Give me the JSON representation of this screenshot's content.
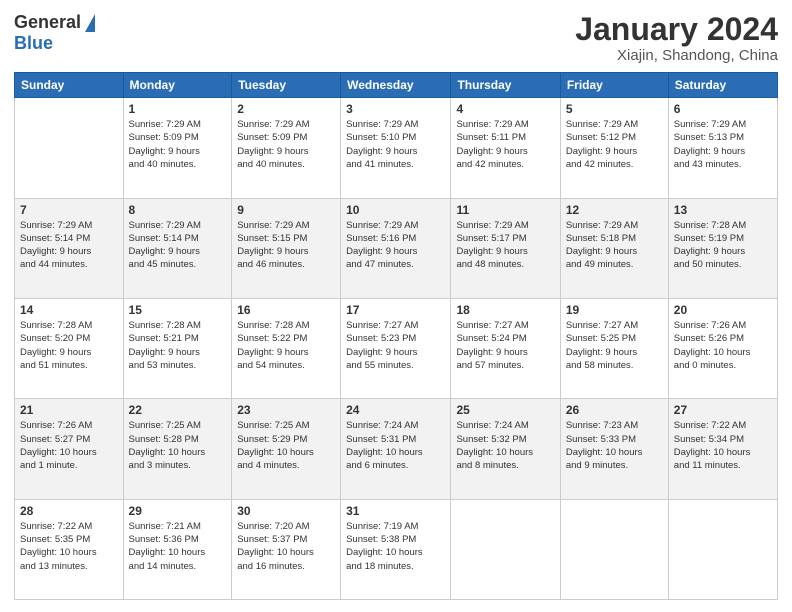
{
  "logo": {
    "general": "General",
    "blue": "Blue"
  },
  "header": {
    "title": "January 2024",
    "subtitle": "Xiajin, Shandong, China"
  },
  "days_of_week": [
    "Sunday",
    "Monday",
    "Tuesday",
    "Wednesday",
    "Thursday",
    "Friday",
    "Saturday"
  ],
  "weeks": [
    {
      "row_class": "normal",
      "days": [
        {
          "number": "",
          "info": ""
        },
        {
          "number": "1",
          "info": "Sunrise: 7:29 AM\nSunset: 5:09 PM\nDaylight: 9 hours\nand 40 minutes."
        },
        {
          "number": "2",
          "info": "Sunrise: 7:29 AM\nSunset: 5:09 PM\nDaylight: 9 hours\nand 40 minutes."
        },
        {
          "number": "3",
          "info": "Sunrise: 7:29 AM\nSunset: 5:10 PM\nDaylight: 9 hours\nand 41 minutes."
        },
        {
          "number": "4",
          "info": "Sunrise: 7:29 AM\nSunset: 5:11 PM\nDaylight: 9 hours\nand 42 minutes."
        },
        {
          "number": "5",
          "info": "Sunrise: 7:29 AM\nSunset: 5:12 PM\nDaylight: 9 hours\nand 42 minutes."
        },
        {
          "number": "6",
          "info": "Sunrise: 7:29 AM\nSunset: 5:13 PM\nDaylight: 9 hours\nand 43 minutes."
        }
      ]
    },
    {
      "row_class": "alt",
      "days": [
        {
          "number": "7",
          "info": "Sunrise: 7:29 AM\nSunset: 5:14 PM\nDaylight: 9 hours\nand 44 minutes."
        },
        {
          "number": "8",
          "info": "Sunrise: 7:29 AM\nSunset: 5:14 PM\nDaylight: 9 hours\nand 45 minutes."
        },
        {
          "number": "9",
          "info": "Sunrise: 7:29 AM\nSunset: 5:15 PM\nDaylight: 9 hours\nand 46 minutes."
        },
        {
          "number": "10",
          "info": "Sunrise: 7:29 AM\nSunset: 5:16 PM\nDaylight: 9 hours\nand 47 minutes."
        },
        {
          "number": "11",
          "info": "Sunrise: 7:29 AM\nSunset: 5:17 PM\nDaylight: 9 hours\nand 48 minutes."
        },
        {
          "number": "12",
          "info": "Sunrise: 7:29 AM\nSunset: 5:18 PM\nDaylight: 9 hours\nand 49 minutes."
        },
        {
          "number": "13",
          "info": "Sunrise: 7:28 AM\nSunset: 5:19 PM\nDaylight: 9 hours\nand 50 minutes."
        }
      ]
    },
    {
      "row_class": "normal",
      "days": [
        {
          "number": "14",
          "info": "Sunrise: 7:28 AM\nSunset: 5:20 PM\nDaylight: 9 hours\nand 51 minutes."
        },
        {
          "number": "15",
          "info": "Sunrise: 7:28 AM\nSunset: 5:21 PM\nDaylight: 9 hours\nand 53 minutes."
        },
        {
          "number": "16",
          "info": "Sunrise: 7:28 AM\nSunset: 5:22 PM\nDaylight: 9 hours\nand 54 minutes."
        },
        {
          "number": "17",
          "info": "Sunrise: 7:27 AM\nSunset: 5:23 PM\nDaylight: 9 hours\nand 55 minutes."
        },
        {
          "number": "18",
          "info": "Sunrise: 7:27 AM\nSunset: 5:24 PM\nDaylight: 9 hours\nand 57 minutes."
        },
        {
          "number": "19",
          "info": "Sunrise: 7:27 AM\nSunset: 5:25 PM\nDaylight: 9 hours\nand 58 minutes."
        },
        {
          "number": "20",
          "info": "Sunrise: 7:26 AM\nSunset: 5:26 PM\nDaylight: 10 hours\nand 0 minutes."
        }
      ]
    },
    {
      "row_class": "alt",
      "days": [
        {
          "number": "21",
          "info": "Sunrise: 7:26 AM\nSunset: 5:27 PM\nDaylight: 10 hours\nand 1 minute."
        },
        {
          "number": "22",
          "info": "Sunrise: 7:25 AM\nSunset: 5:28 PM\nDaylight: 10 hours\nand 3 minutes."
        },
        {
          "number": "23",
          "info": "Sunrise: 7:25 AM\nSunset: 5:29 PM\nDaylight: 10 hours\nand 4 minutes."
        },
        {
          "number": "24",
          "info": "Sunrise: 7:24 AM\nSunset: 5:31 PM\nDaylight: 10 hours\nand 6 minutes."
        },
        {
          "number": "25",
          "info": "Sunrise: 7:24 AM\nSunset: 5:32 PM\nDaylight: 10 hours\nand 8 minutes."
        },
        {
          "number": "26",
          "info": "Sunrise: 7:23 AM\nSunset: 5:33 PM\nDaylight: 10 hours\nand 9 minutes."
        },
        {
          "number": "27",
          "info": "Sunrise: 7:22 AM\nSunset: 5:34 PM\nDaylight: 10 hours\nand 11 minutes."
        }
      ]
    },
    {
      "row_class": "normal",
      "days": [
        {
          "number": "28",
          "info": "Sunrise: 7:22 AM\nSunset: 5:35 PM\nDaylight: 10 hours\nand 13 minutes."
        },
        {
          "number": "29",
          "info": "Sunrise: 7:21 AM\nSunset: 5:36 PM\nDaylight: 10 hours\nand 14 minutes."
        },
        {
          "number": "30",
          "info": "Sunrise: 7:20 AM\nSunset: 5:37 PM\nDaylight: 10 hours\nand 16 minutes."
        },
        {
          "number": "31",
          "info": "Sunrise: 7:19 AM\nSunset: 5:38 PM\nDaylight: 10 hours\nand 18 minutes."
        },
        {
          "number": "",
          "info": ""
        },
        {
          "number": "",
          "info": ""
        },
        {
          "number": "",
          "info": ""
        }
      ]
    }
  ]
}
